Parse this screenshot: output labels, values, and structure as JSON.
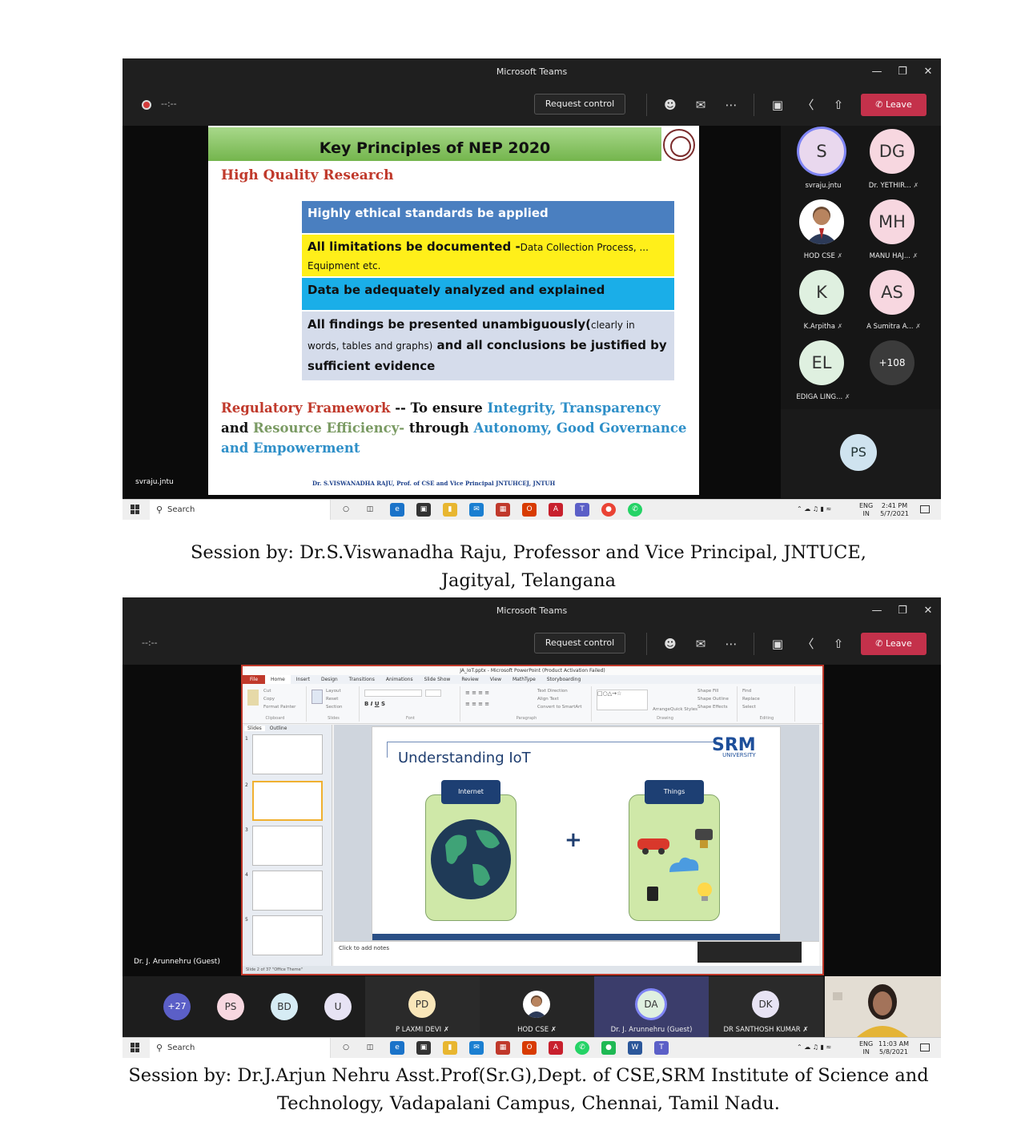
{
  "session1": {
    "window_title": "Microsoft Teams",
    "timer": "--:--",
    "request_control": "Request control",
    "leave": "Leave",
    "slide": {
      "title": "Key Principles of NEP 2020",
      "subtitle": "High Quality Research",
      "boxes": [
        {
          "main": "Highly ethical standards be applied",
          "color": "#4a7fc0"
        },
        {
          "main": "All limitations be documented -",
          "small": "Data Collection Process, ...",
          "small2": "Equipment etc.",
          "color": "#ffef1a"
        },
        {
          "main": "Data be adequately analyzed and explained",
          "color": "#1aaee8"
        },
        {
          "main": "All findings be presented unambiguously(",
          "small": "clearly in",
          "small2": "words, tables and graphs)",
          "main2": "and all conclusions be justified by sufficient evidence",
          "color": "#d5dceb"
        }
      ],
      "footer_parts": [
        {
          "t": "Regulatory Framework",
          "c": "#c0392b"
        },
        {
          "t": " -- To ensure ",
          "c": "#111"
        },
        {
          "t": "Integrity, Transparency",
          "c": "#2e8fc8"
        },
        {
          "t": " and ",
          "c": "#111"
        },
        {
          "t": "Resource Efficiency-",
          "c": "#7a9a63"
        },
        {
          "t": " through ",
          "c": "#111"
        },
        {
          "t": "Autonomy, Good Governance",
          "c": "#2e8fc8"
        },
        {
          "t": " and ",
          "c": "#2e8fc8"
        },
        {
          "t": "Empowerment",
          "c": "#2e8fc8"
        }
      ],
      "credit": "Dr. S.VISWANADHA RAJU,  Prof. of CSE and Vice Principal JNTUHCEJ,        JNTUH"
    },
    "presenter_label": "svraju.jntu",
    "participants": [
      {
        "initials": "S",
        "name": "svraju.jntu",
        "bg": "#e9d8ee"
      },
      {
        "initials": "DG",
        "name": "Dr. YETHIR...",
        "bg": "#f7d7e0"
      },
      {
        "initials": "",
        "name": "HOD CSE",
        "bg": "#ffffff",
        "photo": true
      },
      {
        "initials": "MH",
        "name": "MANU HAJ...",
        "bg": "#f7d7e0"
      },
      {
        "initials": "K",
        "name": "K.Arpitha",
        "bg": "#dff0e0"
      },
      {
        "initials": "AS",
        "name": "A Sumitra A...",
        "bg": "#f7d7e0"
      },
      {
        "initials": "EL",
        "name": "EDIGA LING...",
        "bg": "#dff0e0"
      },
      {
        "initials": "+108",
        "name": "",
        "bg": "#3b3b3b"
      }
    ],
    "self_initials": "PS",
    "taskbar": {
      "search": "Search",
      "lang": "ENG",
      "region": "IN",
      "time": "2:41 PM",
      "date": "5/7/2021"
    }
  },
  "caption1": "Session by:  Dr.S.Viswanadha Raju, Professor and Vice Principal, JNTUCE, Jagityal, Telangana",
  "session2": {
    "window_title": "Microsoft Teams",
    "timer": "--:--",
    "request_control": "Request control",
    "leave": "Leave",
    "ppt_title": "JA_IoT.pptx - Microsoft PowerPoint (Product Activation Failed)",
    "ppt_tabs": [
      "File",
      "Home",
      "Insert",
      "Design",
      "Transitions",
      "Animations",
      "Slide Show",
      "Review",
      "View",
      "MathType",
      "Storyboarding"
    ],
    "ribbon_groups": [
      "Clipboard",
      "Slides",
      "Font",
      "Paragraph",
      "Drawing",
      "Editing"
    ],
    "ribbon_items": {
      "clipboard": [
        "Cut",
        "Copy",
        "Format Painter"
      ],
      "slides": [
        "Layout",
        "Reset",
        "Section"
      ],
      "drawing": [
        "Arrange",
        "Quick Styles",
        "Shape Fill",
        "Shape Outline",
        "Shape Effects"
      ],
      "paragraph": [
        "Text Direction",
        "Align Text",
        "Convert to SmartArt"
      ],
      "editing": [
        "Find",
        "Replace",
        "Select"
      ]
    },
    "side_tabs": [
      "Slides",
      "Outline"
    ],
    "slide_title": "Understanding IoT",
    "logo": "SRM",
    "logo_sub": "UNIVERSITY",
    "card_left": "Internet",
    "card_right": "Things",
    "notes": "Click to add notes",
    "status": "Slide 2 of 37   \"Office Theme\"",
    "presenter_label": "Dr. J. Arunnehru (Guest)",
    "strip": [
      {
        "initials": "+27",
        "bg": "#5b5fc7",
        "fg": "#fff"
      },
      {
        "initials": "PS",
        "bg": "#f7d7e0",
        "fg": "#333"
      },
      {
        "initials": "BD",
        "bg": "#d6ecf4",
        "fg": "#333"
      },
      {
        "initials": "U",
        "bg": "#e7e3f4",
        "fg": "#333"
      }
    ],
    "tiles": [
      {
        "initials": "PD",
        "name": "P LAXMI DEVI",
        "bg": "#f9e6b9"
      },
      {
        "initials": "",
        "name": "HOD CSE",
        "bg": "#fff",
        "photo": true
      },
      {
        "initials": "DA",
        "name": "Dr. J. Arunnehru (Guest)",
        "bg": "#dff0e0"
      },
      {
        "initials": "DK",
        "name": "DR SANTHOSH KUMAR",
        "bg": "#e7e3f4"
      }
    ],
    "taskbar": {
      "search": "Search",
      "lang": "ENG",
      "region": "IN",
      "time": "11:03 AM",
      "date": "5/8/2021"
    }
  },
  "caption2": "Session by: Dr.J.Arjun Nehru Asst.Prof(Sr.G),Dept. of CSE,SRM Institute of Science and Technology, Vadapalani Campus, Chennai, Tamil Nadu."
}
